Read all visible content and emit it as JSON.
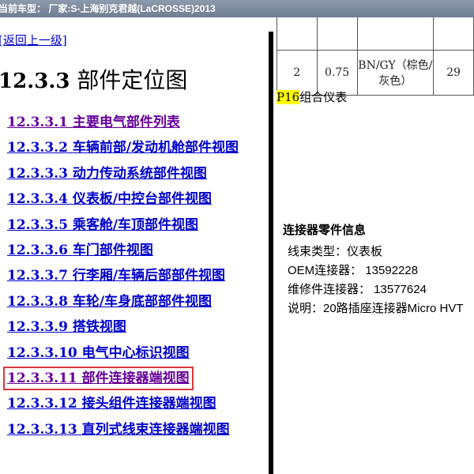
{
  "topbar": {
    "text": "当前车型： 厂家:S-上海别克君越(LaCROSSE)2013"
  },
  "left": {
    "back_link": "[返回上一级]",
    "section_number": "12.3.3",
    "section_title": "部件定位图",
    "toc": [
      {
        "num": "12.3.3.1",
        "label": "主要电气部件列表",
        "visited": true,
        "selected": false
      },
      {
        "num": "12.3.3.2",
        "label": "车辆前部/发动机舱部件视图",
        "visited": false,
        "selected": false
      },
      {
        "num": "12.3.3.3",
        "label": "动力传动系统部件视图",
        "visited": false,
        "selected": false
      },
      {
        "num": "12.3.3.4",
        "label": "仪表板/中控台部件视图",
        "visited": false,
        "selected": false
      },
      {
        "num": "12.3.3.5",
        "label": "乘客舱/车顶部件视图",
        "visited": false,
        "selected": false
      },
      {
        "num": "12.3.3.6",
        "label": "车门部件视图",
        "visited": false,
        "selected": false
      },
      {
        "num": "12.3.3.7",
        "label": "行李厢/车辆后部部件视图",
        "visited": false,
        "selected": false
      },
      {
        "num": "12.3.3.8",
        "label": "车轮/车身底部部件视图",
        "visited": false,
        "selected": false
      },
      {
        "num": "12.3.3.9",
        "label": "搭铁视图",
        "visited": false,
        "selected": false
      },
      {
        "num": "12.3.3.10",
        "label": "电气中心标识视图",
        "visited": false,
        "selected": false
      },
      {
        "num": "12.3.3.11",
        "label": "部件连接器端视图",
        "visited": true,
        "selected": true
      },
      {
        "num": "12.3.3.12",
        "label": "接头组件连接器端视图",
        "visited": false,
        "selected": false
      },
      {
        "num": "12.3.3.13",
        "label": "直列式线束连接器端视图",
        "visited": false,
        "selected": false
      }
    ]
  },
  "right": {
    "table_row": {
      "pin": "2",
      "gauge": "0.75",
      "color": "BN/GY（棕色/灰色）",
      "circuit": "29"
    },
    "connector_id": "P16",
    "connector_name": "组合仪表",
    "info_title": "连接器零件信息",
    "info_rows": [
      "线束类型：仪表板",
      "OEM连接器： 13592228",
      "维修件连接器： 13577624",
      "说明：20路插座连接器Micro HVT"
    ]
  }
}
